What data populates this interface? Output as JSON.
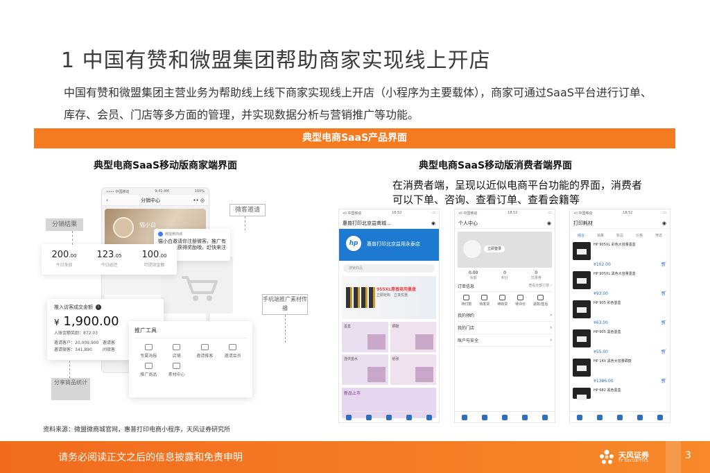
{
  "title": "1 中国有赞和微盟集团帮助商家实现线上开店",
  "intro": "中国有赞和微盟集团主营业务为帮助线上线下商家实现线上开店（小程序为主要载体），商家可通过SaaS平台进行订单、库存、会员、门店等多方面的管理，并实现数据分析与营销推广等功能。",
  "banner": "典型电商SaaS产品界面",
  "left_subtitle": "典型电商SaaS移动版商家端界面",
  "right_subtitle": "典型电商SaaS移动版消费者端界面",
  "right_desc": "在消费者端，呈现以近似电商平台功能的界面，消费者可以下单、咨询、查看订单、查看会籍等",
  "merchant": {
    "phone_status": {
      "carrier": "•••• 中国移动",
      "time": "9:41 AM",
      "battery": "100%"
    },
    "phone_nav": {
      "back": "‹",
      "title": "分销中心",
      "more": "•• ◎"
    },
    "hero_user": "猫小白",
    "menu_items": [
      "订货单跟踪",
      "推广业绩"
    ],
    "stats": [
      {
        "value": "200",
        "decimals": ".00",
        "label": "今日发放"
      },
      {
        "value": "123",
        "decimals": ".05",
        "label": "今日返还"
      },
      {
        "value": "100",
        "decimals": ".00",
        "label": "可提现金额"
      }
    ],
    "notify": {
      "app": "微盟微商城",
      "text": "猫小白邀请你注册微客，推广有收益还能获得奖励哦，赶快来注册吧！"
    },
    "income": {
      "title": "推入访客成交金额",
      "info": "i",
      "currency": "¥",
      "amount": "1,900.00",
      "sub": "入账金额奖励：872.03",
      "rows": [
        {
          "left": "邀请客户：20,009,900",
          "right": "邀请客"
        },
        {
          "left": "邀请微客：341,890",
          "right": "间接客"
        }
      ]
    },
    "tools": {
      "title": "推广工具",
      "items": [
        "专属海报",
        "店铺",
        "邀请推客",
        "邀请会员",
        "推广商品",
        "素材中心"
      ]
    },
    "callouts": [
      "分销结果",
      "微客邀请",
      "手机端推广素材传播",
      "分享商品统计"
    ]
  },
  "consumer": {
    "phone1": {
      "status": {
        "carrier": "•ll 中国移动",
        "time": "18:52",
        "battery": "▭"
      },
      "nav_title": "惠普打印北京益商城…",
      "store_logo": "hp",
      "store_name": "惠普打印北京益用永泰店",
      "search": "搜索商品",
      "banner_title": "955XL惠普商用墨盒",
      "banner_sub": "立即抢购　立享优惠",
      "categories": [
        "墨盒",
        "硒鼓",
        "连供墨水",
        "纸张"
      ],
      "new_label": "新品上市"
    },
    "phone2": {
      "status": {
        "carrier": "•ll 中国移动",
        "time": "18:52",
        "battery": "▭"
      },
      "nav_title": "个人中心",
      "login": "立即登录",
      "stats": [
        {
          "value": "0.00",
          "label": "余额"
        },
        {
          "value": "0",
          "label": "积分"
        },
        {
          "value": "0",
          "label": "优惠券"
        }
      ],
      "order_title": "订单信息",
      "order_more": "查看全部订单 ›",
      "order_icons": [
        "待付款",
        "待发货",
        "待收货",
        "待评价",
        "退款/售后"
      ],
      "menus": [
        "我的预约",
        "我的门店",
        "账户与安全"
      ]
    },
    "phone3": {
      "status": {
        "carrier": "•ll 中国移动",
        "time": "18:52",
        "battery": "▭"
      },
      "nav_title": "打印耗材",
      "filters": [
        "综合",
        "销量",
        "新品",
        "价格",
        "筛选"
      ],
      "products": [
        {
          "name": "HP 905XL 彩色大容量墨盒",
          "price": "¥102.00"
        },
        {
          "name": "HP 905XL 黑色大容量墨盒",
          "price": "¥93.00"
        },
        {
          "name": "HP 905 彩色墨盒",
          "price": "¥63.00"
        },
        {
          "name": "HP 905 黑色墨盒",
          "price": "¥55.00"
        },
        {
          "name": "HP 14X 黑色大容量硒鼓",
          "price": "¥1386.00"
        },
        {
          "name": "HP 682 黑色墨盒",
          "price": ""
        }
      ]
    }
  },
  "source": "资料来源：微盟微商城官网，惠普打印电商小程序，天风证券研究所",
  "footer": {
    "text": "请务必阅读正文之后的信息披露和免责申明",
    "logo_name": "天风证券",
    "logo_sub": "TF SECURITIES",
    "page": "3"
  },
  "colors": {
    "accent": "#f47b20",
    "hp_blue": "#1e7ad0"
  }
}
